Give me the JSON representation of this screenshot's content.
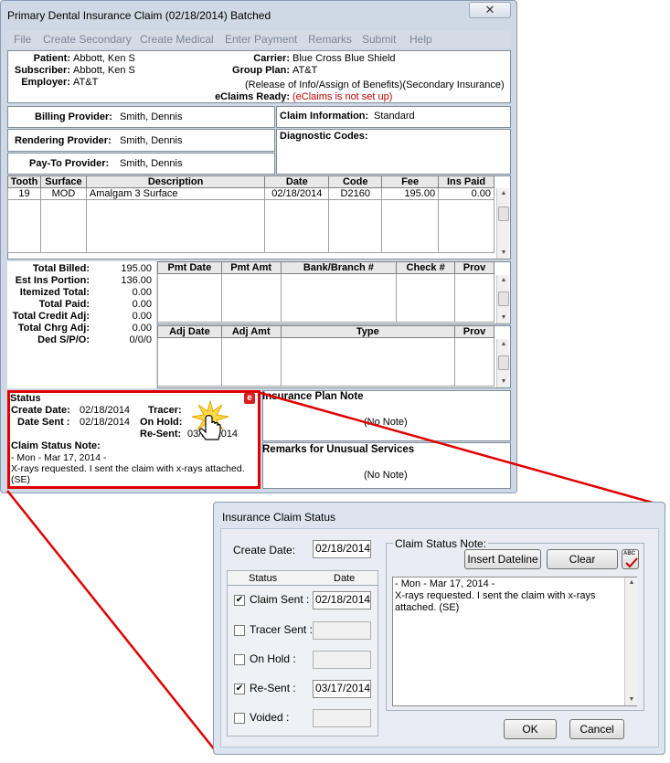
{
  "window": {
    "title": "Primary Dental Insurance Claim (02/18/2014) Batched",
    "close": "✕"
  },
  "menu": [
    "File",
    "Create Secondary",
    "Create Medical",
    "Enter Payment",
    "Remarks",
    "Submit",
    "Help"
  ],
  "header": {
    "patient_label": "Patient:",
    "patient": "Abbott, Ken S",
    "subscriber_label": "Subscriber:",
    "subscriber": "Abbott, Ken S",
    "employer_label": "Employer:",
    "employer": "AT&T",
    "carrier_label": "Carrier:",
    "carrier": "Blue Cross Blue Shield",
    "group_plan_label": "Group Plan:",
    "group_plan": "AT&T",
    "release_text": "(Release of Info/Assign of Benefits)(Secondary Insurance)",
    "eclaims_label": "eClaims Ready:",
    "eclaims": "(eClaims is not set up)"
  },
  "providers": {
    "billing_label": "Billing Provider:",
    "billing": "Smith, Dennis",
    "rendering_label": "Rendering Provider:",
    "rendering": "Smith, Dennis",
    "payto_label": "Pay-To Provider:",
    "payto": "Smith, Dennis",
    "claim_info_label": "Claim Information:",
    "claim_info": "Standard",
    "diagnostic_label": "Diagnostic Codes:"
  },
  "procedures": {
    "headers": [
      "Tooth",
      "Surface",
      "Description",
      "Date",
      "Code",
      "Fee",
      "Ins Paid"
    ],
    "rows": [
      [
        "19",
        "MOD",
        "Amalgam 3 Surface",
        "02/18/2014",
        "D2160",
        "195.00",
        "0.00"
      ]
    ]
  },
  "totals": [
    {
      "label": "Total Billed:",
      "value": "195.00"
    },
    {
      "label": "Est Ins Portion:",
      "value": "136.00"
    },
    {
      "label": "Itemized Total:",
      "value": "0.00"
    },
    {
      "label": "Total Paid:",
      "value": "0.00"
    },
    {
      "label": "Total Credit Adj:",
      "value": "0.00"
    },
    {
      "label": "Total Chrg Adj:",
      "value": "0.00"
    },
    {
      "label": "Ded S/P/O:",
      "value": "0/0/0"
    }
  ],
  "payments": {
    "headers": [
      "Pmt Date",
      "Pmt Amt",
      "Bank/Branch #",
      "Check #",
      "Prov"
    ]
  },
  "adjustments": {
    "headers": [
      "Adj Date",
      "Adj Amt",
      "Type",
      "Prov"
    ]
  },
  "status": {
    "title": "Status",
    "create_date_label": "Create Date:",
    "create_date": "02/18/2014",
    "date_sent_label": "Date Sent :",
    "date_sent": "02/18/2014",
    "tracer_label": "Tracer:",
    "on_hold_label": "On Hold:",
    "resent_label": "Re-Sent:",
    "resent": "03/17/2014",
    "note_label": "Claim Status Note:",
    "note_line1": "- Mon - Mar 17, 2014 -",
    "note_line2": "X-rays requested. I sent the claim with x-rays attached.",
    "note_line3": "(SE)",
    "e_icon": "e"
  },
  "insurance_plan_note": {
    "title": "Insurance Plan Note",
    "text": "(No Note)"
  },
  "remarks": {
    "title": "Remarks for Unusual Services",
    "text": "(No Note)"
  },
  "dialog": {
    "title": "Insurance Claim Status",
    "create_date_label": "Create Date:",
    "create_date": "02/18/2014",
    "col_status": "Status",
    "col_date": "Date",
    "rows": [
      {
        "label": "Claim Sent :",
        "checked": true,
        "date": "02/18/2014"
      },
      {
        "label": "Tracer Sent :",
        "checked": false,
        "date": ""
      },
      {
        "label": "On Hold :",
        "checked": false,
        "date": ""
      },
      {
        "label": "Re-Sent :",
        "checked": true,
        "date": "03/17/2014"
      },
      {
        "label": "Voided :",
        "checked": false,
        "date": ""
      }
    ],
    "note_group_label": "Claim Status Note:",
    "insert_dateline": "Insert Dateline",
    "clear": "Clear",
    "spell_icon": "ABC",
    "note_line1": "- Mon - Mar 17, 2014 -",
    "note_line2": "X-rays requested. I sent the claim with x-rays",
    "note_line3": "attached. (SE)",
    "ok": "OK",
    "cancel": "Cancel"
  },
  "colors": {
    "highlight": "#e00000",
    "window_bg": "#cfd9e6"
  }
}
